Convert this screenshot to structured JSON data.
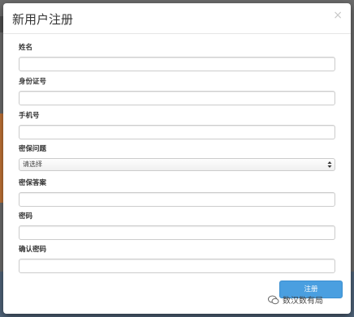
{
  "modal": {
    "title": "新用户注册",
    "close_symbol": "×",
    "fields": [
      {
        "label": "姓名",
        "value": "",
        "type": "text"
      },
      {
        "label": "身份证号",
        "value": "",
        "type": "text"
      },
      {
        "label": "手机号",
        "value": "",
        "type": "text"
      },
      {
        "label": "密保问题",
        "selected": "请选择",
        "type": "select"
      },
      {
        "label": "密保答案",
        "value": "",
        "type": "text"
      },
      {
        "label": "密码",
        "value": "",
        "type": "password"
      },
      {
        "label": "确认密码",
        "value": "",
        "type": "password"
      }
    ],
    "submit_label": "注册"
  },
  "watermark": {
    "text": "数汉数有局"
  },
  "colors": {
    "primary_button": "#4a9fe0",
    "overlay": "#6b6b6b"
  }
}
